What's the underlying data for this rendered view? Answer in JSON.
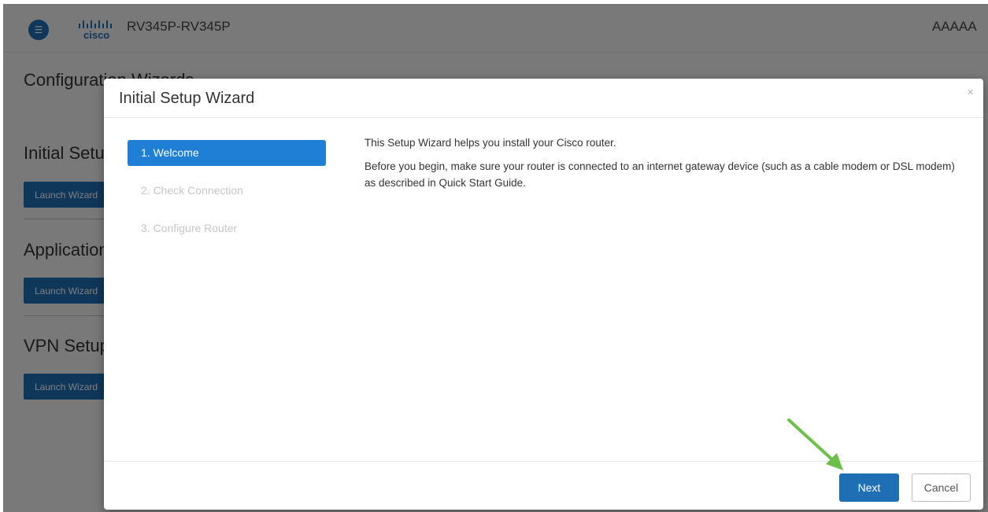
{
  "header": {
    "device_name": "RV345P-RV345P",
    "user_name": "AAAAA",
    "logo_text": "cisco"
  },
  "page": {
    "title": "Configuration Wizards",
    "sections": [
      {
        "title": "Initial Setup Wizard",
        "button": "Launch Wizard"
      },
      {
        "title": "Application Setup Wizard",
        "button": "Launch Wizard"
      },
      {
        "title": "VPN Setup Wizard",
        "button": "Launch Wizard"
      }
    ]
  },
  "modal": {
    "title": "Initial Setup Wizard",
    "close_symbol": "×",
    "steps": [
      {
        "label": "1. Welcome",
        "active": true
      },
      {
        "label": "2. Check Connection",
        "active": false
      },
      {
        "label": "3. Configure Router",
        "active": false
      }
    ],
    "content": {
      "line1": "This Setup Wizard helps you install your Cisco router.",
      "line2": "Before you begin, make sure your router is connected to an internet gateway device (such as a cable modem or DSL modem) as described in Quick Start Guide."
    },
    "footer": {
      "next_label": "Next",
      "cancel_label": "Cancel"
    }
  },
  "colors": {
    "primary": "#1e6fb4",
    "active_step": "#1e7fd4",
    "annotation_arrow": "#6cc04a"
  },
  "icons": {
    "menu_toggle": "collapse-menu-icon",
    "close": "close-icon",
    "annotation": "green-arrow-icon"
  }
}
